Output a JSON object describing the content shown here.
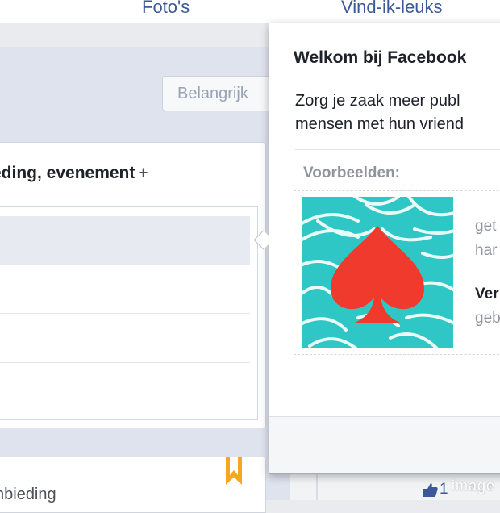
{
  "top_nav": {
    "links": [
      "Foto's",
      "Vind-ik-leuks"
    ]
  },
  "filter": {
    "label": "Belangrijk"
  },
  "composer": {
    "title": "eding, evenement",
    "add_symbol": "+"
  },
  "feed": {
    "post_text": "nbieding"
  },
  "popover": {
    "title": "Welkom bij Facebook",
    "body_lines": [
      "Zorg je zaak meer publ",
      "mensen met hun vriend"
    ],
    "examples_label": "Voorbeelden:",
    "example_text": {
      "line1": "get",
      "line2": "har",
      "bold": "Ver",
      "line3": "geb"
    }
  },
  "likes": {
    "count": "1"
  },
  "watermark": "image",
  "icons": {
    "bookmark": "bookmark-icon",
    "thumb": "thumbs-up-icon",
    "add": "plus-icon"
  },
  "colors": {
    "link": "#3b5998",
    "bookmark": "#f5a623",
    "example_bg": "#2fc6c6",
    "example_spade": "#f03a2e"
  }
}
